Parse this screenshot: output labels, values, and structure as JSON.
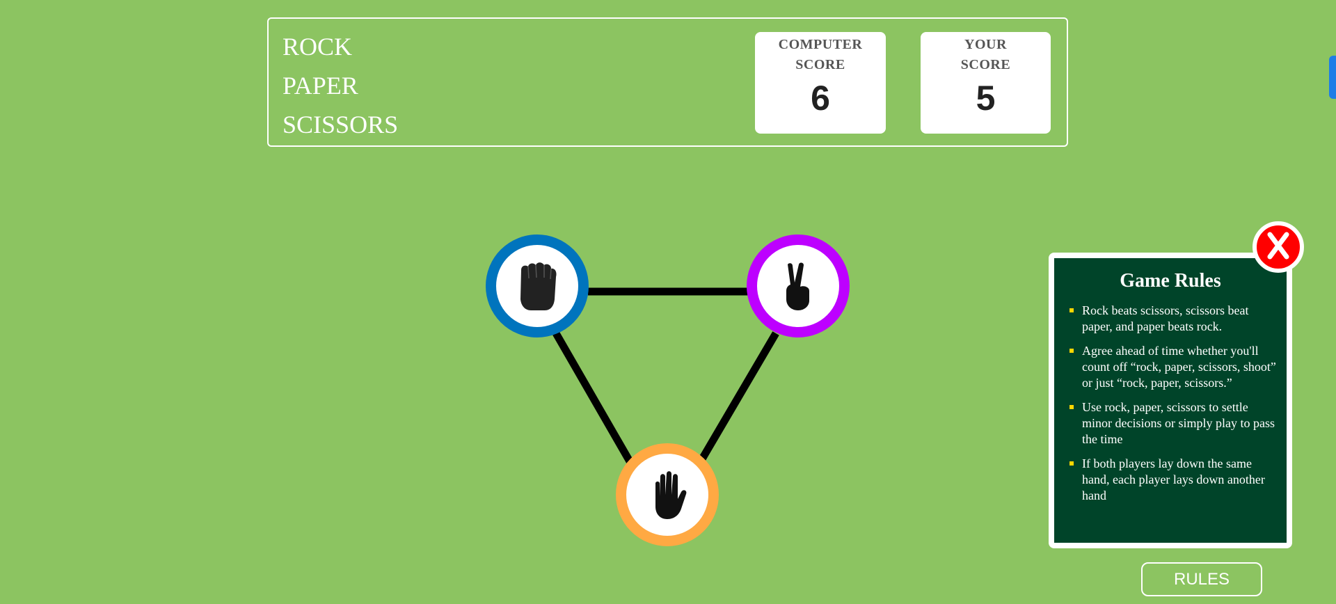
{
  "header": {
    "title_lines": [
      "ROCK",
      "PAPER",
      "SCISSORS"
    ],
    "computer_score": {
      "label_lines": [
        "COMPUTER",
        "SCORE"
      ],
      "value": "6"
    },
    "player_score": {
      "label_lines": [
        "YOUR",
        "SCORE"
      ],
      "value": "5"
    }
  },
  "choices": [
    {
      "name": "rock",
      "icon": "fist-icon",
      "color": "#0074bd"
    },
    {
      "name": "scissors",
      "icon": "victory-hand-icon",
      "color": "#bd00ff"
    },
    {
      "name": "paper",
      "icon": "open-hand-icon",
      "color": "#ffa943"
    }
  ],
  "rules": {
    "title": "Game Rules",
    "items": [
      "Rock beats scissors, scissors beat paper, and paper beats rock.",
      "Agree ahead of time whether you'll count off “rock, paper, scissors, shoot” or just “rock, paper, scissors.”",
      "Use rock, paper, scissors to settle minor decisions or simply play to pass the time",
      "If both players lay down the same hand, each player lays down another hand"
    ],
    "close_icon": "close-icon",
    "button_label": "RULES"
  },
  "colors": {
    "background": "#8cc461",
    "rules_panel": "#004429",
    "close_button": "#ff0000",
    "bullet": "#ffd700"
  }
}
